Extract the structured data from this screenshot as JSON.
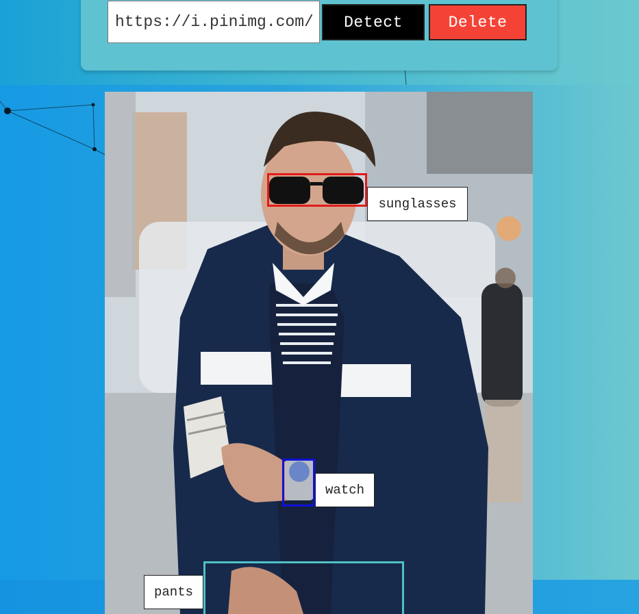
{
  "controls": {
    "url_value": "https://i.pinimg.com/",
    "detect_label": "Detect",
    "delete_label": "Delete"
  },
  "colors": {
    "detect_button": "#000000",
    "delete_button": "#f44336",
    "sunglasses_box": "#e21b1b",
    "watch_box": "#1010d8",
    "pants_box": "#4fc1c6"
  },
  "detections": [
    {
      "label": "sunglasses"
    },
    {
      "label": "watch"
    },
    {
      "label": "pants"
    }
  ]
}
